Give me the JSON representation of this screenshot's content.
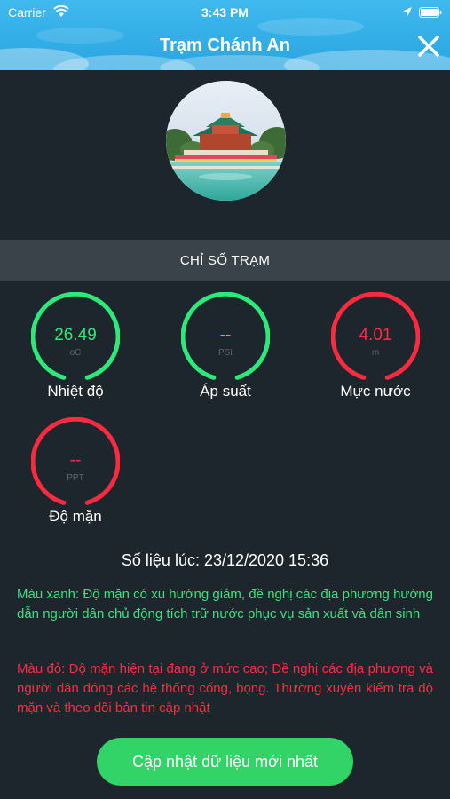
{
  "status_bar": {
    "carrier": "Carrier",
    "time": "3:43 PM",
    "wifi_icon": "wifi-icon",
    "location_icon": "location-arrow-icon",
    "battery_icon": "battery-icon"
  },
  "header": {
    "title": "Trạm Chánh An",
    "close_icon": "close-icon",
    "background_color": "#2aa5e0"
  },
  "station_photo": "temple-photo",
  "section": {
    "title": "CHỈ SỐ TRẠM"
  },
  "gauges": [
    {
      "value": "26.49",
      "unit": "oC",
      "label": "Nhiệt độ",
      "color": "#2ee87a"
    },
    {
      "value": "--",
      "unit": "PSI",
      "label": "Áp suất",
      "color": "#2ee87a"
    },
    {
      "value": "4.01",
      "unit": "m",
      "label": "Mực nước",
      "color": "#ff2a3f"
    },
    {
      "value": "--",
      "unit": "PPT",
      "label": "Độ mặn",
      "color": "#ff2a3f"
    }
  ],
  "timestamp": "Số liệu lúc: 23/12/2020 15:36",
  "notes": {
    "green": "Màu xanh: Độ mặn có xu hướng giảm, đề nghị các địa phương hướng dẫn người dân chủ động tích trữ nước phục vụ sản xuất và dân sinh",
    "red": "Màu đỏ: Độ mặn hiện tại đang ở mức cao; Đề nghị các địa phương và người dân đóng các hệ thống cống, bọng. Thường xuyên kiểm tra độ mặn và theo dõi bản tin cập nhật"
  },
  "update_button": {
    "label": "Cập nhật dữ liệu mới nhất",
    "color": "#33d467"
  }
}
